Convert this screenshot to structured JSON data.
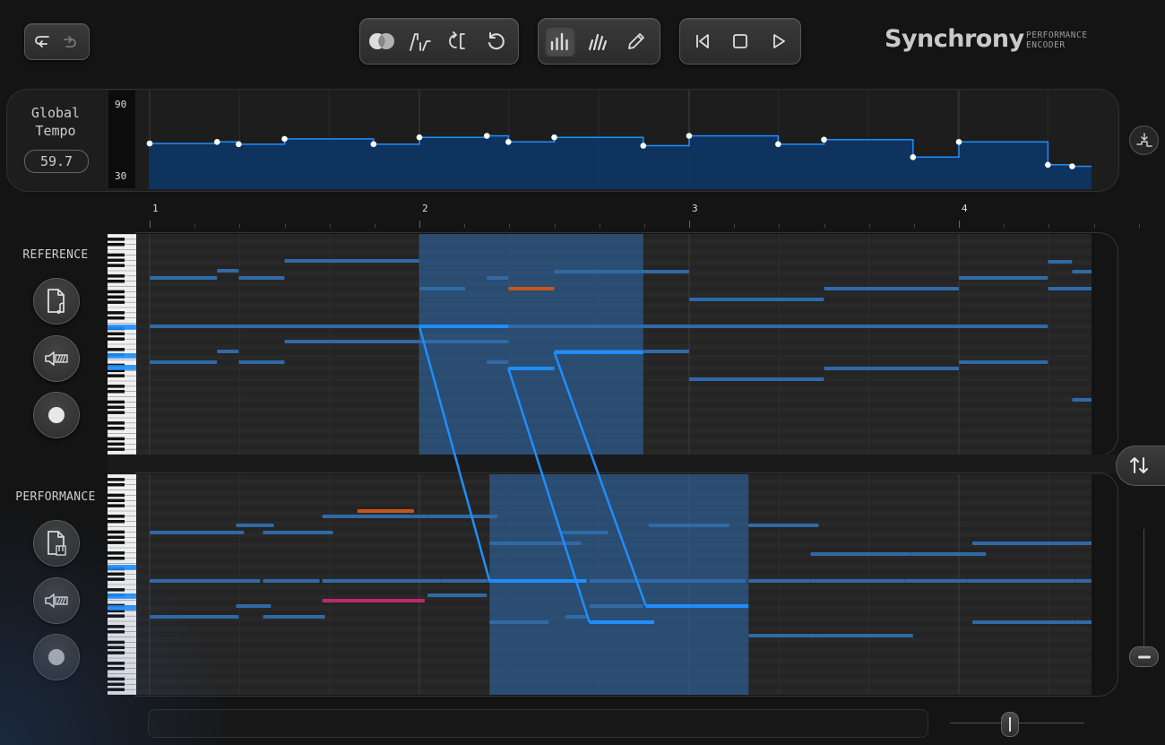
{
  "app": {
    "brand": "Synchrony",
    "subtitle_line1": "PERFORMANCE",
    "subtitle_line2": "ENCODER"
  },
  "toolbar": {
    "history": [
      "undo-icon",
      "redo-icon"
    ],
    "mode_tools": [
      "overlap-toggle-icon",
      "tempo-edit-icon",
      "loop-sync-icon",
      "reset-icon"
    ],
    "view_tools": [
      "bar-view-icon",
      "velocity-view-icon",
      "pencil-icon"
    ],
    "view_active": "bar-view-icon",
    "transport": [
      "skip-back-icon",
      "stop-icon",
      "play-icon"
    ]
  },
  "tempo": {
    "label_line1": "Global",
    "label_line2": "Tempo",
    "value": "59.7",
    "y_max": "90",
    "y_min": "30",
    "range": [
      30,
      90
    ],
    "curve": [
      [
        1.0,
        60
      ],
      [
        1.25,
        61
      ],
      [
        1.33,
        59.5
      ],
      [
        1.5,
        63
      ],
      [
        1.83,
        59.5
      ],
      [
        2.0,
        64
      ],
      [
        2.25,
        65
      ],
      [
        2.33,
        61
      ],
      [
        2.5,
        64
      ],
      [
        2.83,
        58.5
      ],
      [
        3.0,
        65
      ],
      [
        3.33,
        59.5
      ],
      [
        3.5,
        62.5
      ],
      [
        3.83,
        51
      ],
      [
        4.0,
        61
      ],
      [
        4.33,
        46
      ],
      [
        4.42,
        45
      ]
    ]
  },
  "ruler": {
    "bars": [
      "1",
      "2",
      "3",
      "4"
    ]
  },
  "reference": {
    "label": "REFERENCE",
    "buttons": [
      "sheet-music-file-icon",
      "audio-mute-icon",
      "record-icon"
    ],
    "selection": [
      2.0,
      2.83
    ]
  },
  "performance": {
    "label": "PERFORMANCE",
    "buttons": [
      "midi-file-icon",
      "audio-mute-icon",
      "record-icon"
    ],
    "selection": [
      2.26,
      3.22
    ]
  },
  "side": {
    "buttons": [
      "tempo-snap-icon",
      "swap-icon",
      "zoom-out-icon"
    ]
  },
  "colors": {
    "accent": "#1e8eff",
    "note": "#2f6aa6",
    "note_orange": "#c4561a",
    "note_pink": "#c0286a",
    "selection": "#2f6eae"
  }
}
